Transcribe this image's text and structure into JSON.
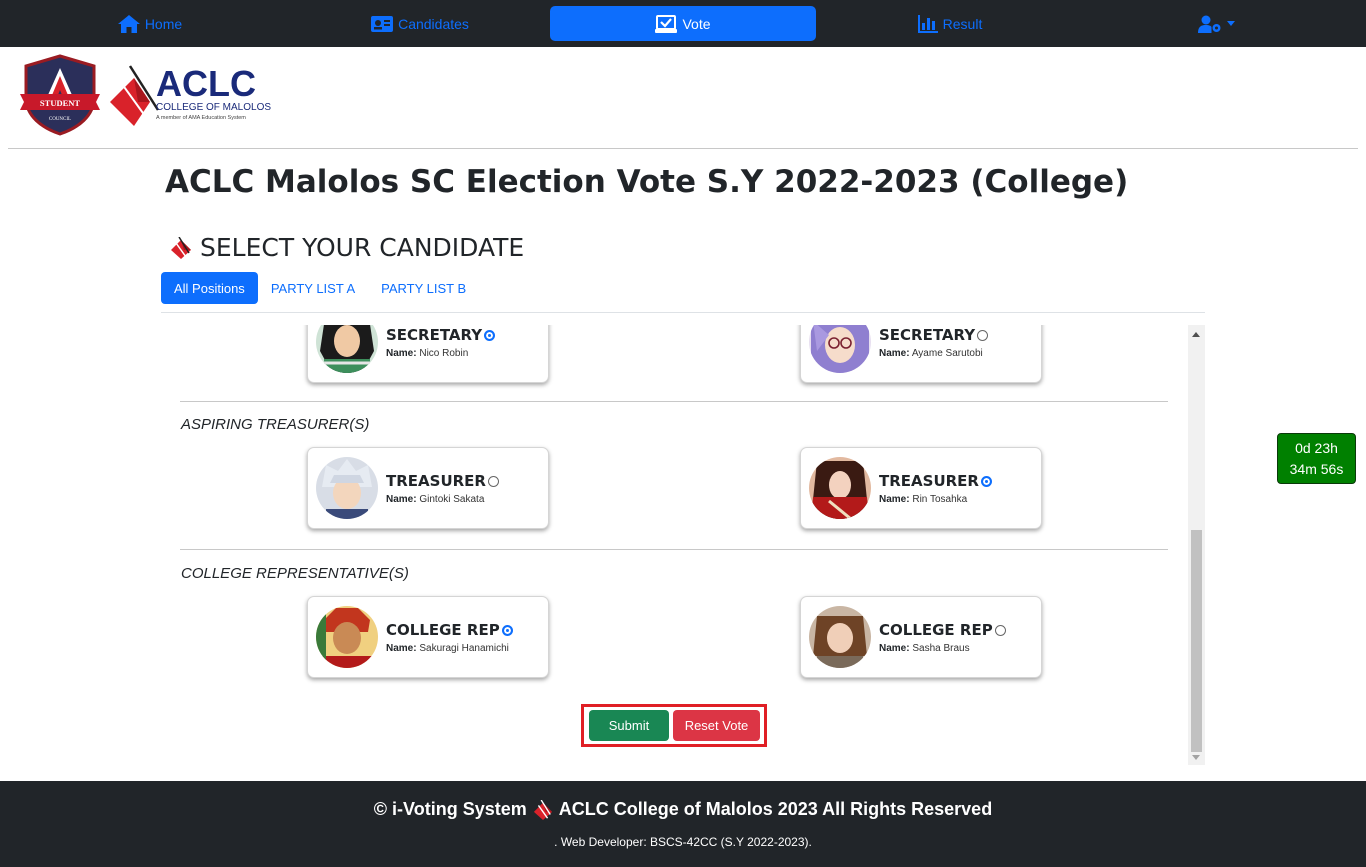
{
  "nav": {
    "home": "Home",
    "candidates": "Candidates",
    "vote": "Vote",
    "result": "Result",
    "active": "Vote"
  },
  "logo": {
    "badge_top": "STUDENT",
    "badge_bottom": "COUNCIL",
    "school_name": "ACLC",
    "school_sub": "COLLEGE OF MALOLOS",
    "school_tag": "A member of AMA Education System"
  },
  "page_title": "ACLC Malolos SC Election Vote S.Y 2022-2023 (College)",
  "select_title": "SELECT YOUR CANDIDATE",
  "tabs": [
    "All Positions",
    "PARTY LIST A",
    "PARTY LIST B"
  ],
  "active_tab": "All Positions",
  "name_label": "Name:",
  "sections": [
    {
      "label": "",
      "candidates": [
        {
          "position": "SECRETARY",
          "name": "Nico Robin",
          "selected": true
        },
        {
          "position": "SECRETARY",
          "name": "Ayame Sarutobi",
          "selected": false
        }
      ]
    },
    {
      "label": "ASPIRING TREASURER(S)",
      "candidates": [
        {
          "position": "TREASURER",
          "name": "Gintoki Sakata",
          "selected": false
        },
        {
          "position": "TREASURER",
          "name": "Rin Tosahka",
          "selected": true
        }
      ]
    },
    {
      "label": "COLLEGE REPRESENTATIVE(S)",
      "candidates": [
        {
          "position": "COLLEGE REP",
          "name": "Sakuragi Hanamichi",
          "selected": true
        },
        {
          "position": "COLLEGE REP",
          "name": "Sasha Braus",
          "selected": false
        }
      ]
    }
  ],
  "buttons": {
    "submit": "Submit",
    "reset": "Reset Vote"
  },
  "timer": {
    "line1": "0d 23h",
    "line2": "34m 56s"
  },
  "footer": {
    "main_left": "© i-Voting System",
    "main_right": "ACLC College of Malolos 2023 All Rights Reserved",
    "sub": ". Web Developer: BSCS-42CC (S.Y 2022-2023)."
  },
  "colors": {
    "accent": "#0d6efd",
    "nav_bg": "#212529",
    "submit": "#198754",
    "reset": "#dc3545",
    "timer": "#008000",
    "highlight": "#e01f25"
  },
  "icons": {
    "home": "home-icon",
    "candidates": "id-card-icon",
    "vote": "ballot-check-icon",
    "result": "bar-chart-icon",
    "user_settings": "user-gear-icon"
  }
}
